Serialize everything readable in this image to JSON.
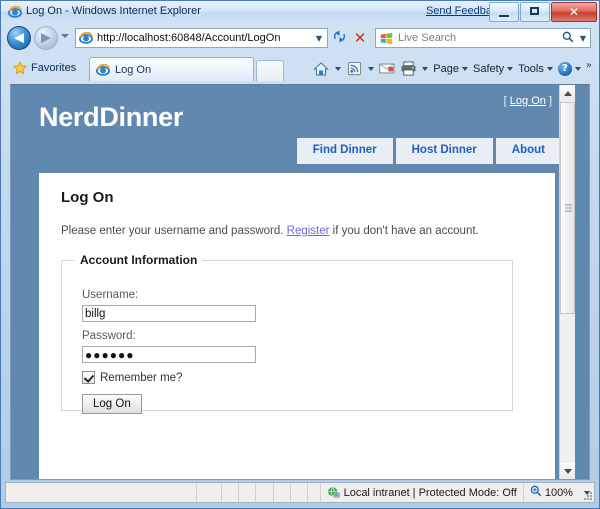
{
  "browser": {
    "window_title": "Log On - Windows Internet Explorer",
    "send_feedback": "Send Feedback",
    "window_buttons": {
      "minimize": "minimize-button",
      "maximize": "maximize-button",
      "close": "✕"
    },
    "address_bar": {
      "url": "http://localhost:60848/Account/LogOn",
      "dropdown_caret": "▼",
      "refresh_label": "↻",
      "stop_label": "✕"
    },
    "search_bar": {
      "placeholder": "Live Search",
      "magnifier": "⚲",
      "caret": "▼"
    },
    "favorites_label": "Favorites",
    "tab": {
      "title": "Log On"
    },
    "toolbar": {
      "home": "home-icon",
      "feeds": "rss-icon",
      "mail": "mail-icon",
      "print": "print-icon",
      "page_label": "Page",
      "safety_label": "Safety",
      "tools_label": "Tools",
      "help_label": "?",
      "overflow": "»"
    },
    "status_bar": {
      "zone_text": "Local intranet | Protected Mode: Off",
      "zoom_level": "100%",
      "zoom_caret": "▼"
    }
  },
  "site": {
    "logo": "NerdDinner",
    "logon_bracket_open": "[",
    "logon_link": "Log On",
    "logon_bracket_close": "]",
    "nav": [
      {
        "label": "Find Dinner"
      },
      {
        "label": "Host Dinner"
      },
      {
        "label": "About"
      }
    ],
    "colors": {
      "header_blue": "#6189b0",
      "nav_tab_bg": "#e8eef4",
      "nav_tab_text": "#1f5fc0",
      "link_purple": "#6b6bd6"
    }
  },
  "content": {
    "heading": "Log On",
    "intro_before": "Please enter your username and password. ",
    "intro_link": "Register",
    "intro_after": " if you don't have an account.",
    "fieldset_legend": "Account Information",
    "username_label": "Username:",
    "username_value": "billg",
    "password_label": "Password:",
    "password_value": "●●●●●●",
    "remember_label": "Remember me?",
    "remember_checked": true,
    "submit_label": "Log On"
  }
}
